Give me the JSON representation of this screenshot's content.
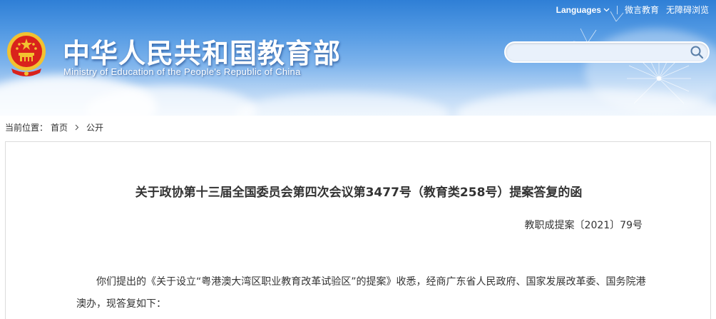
{
  "header": {
    "site_title": "中华人民共和国教育部",
    "site_subtitle": "Ministry of Education of the People's Republic of China",
    "emblem_icon": "national-emblem-icon"
  },
  "topnav": {
    "languages_label": "Languages",
    "weibo_label": "微言教育",
    "accessibility_label": "无障碍浏览"
  },
  "search": {
    "value": "",
    "icon": "search-icon"
  },
  "breadcrumb": {
    "prefix": "当前位置：",
    "items": [
      "首页",
      "公开"
    ]
  },
  "document": {
    "title": "关于政协第十三届全国委员会第四次会议第3477号（教育类258号）提案答复的函",
    "number": "教职成提案〔2021〕79号",
    "body": "你们提出的《关于设立“粤港澳大湾区职业教育改革试验区”的提案》收悉，经商广东省人民政府、国家发展改革委、国务院港澳办，现答复如下："
  },
  "colors": {
    "banner_top": "#2f7fd6",
    "banner_bottom": "#dcebfb",
    "text": "#333333",
    "emblem_red": "#d9221c",
    "emblem_gold": "#f2c230"
  }
}
